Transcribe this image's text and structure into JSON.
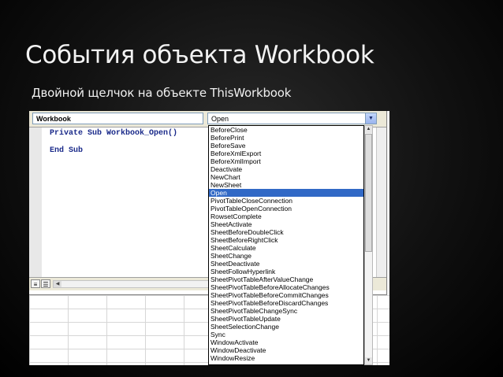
{
  "slide": {
    "title": "События объекта Workbook",
    "subtitle": "Двойной щелчок на объекте ThisWorkbook"
  },
  "vbe": {
    "object_combo_value": "Workbook",
    "procedure_combo_value": "Open",
    "code_lines": [
      "Private Sub Workbook_Open()",
      "End Sub"
    ]
  },
  "dropdown": {
    "selected": "Open",
    "items": [
      "BeforeClose",
      "BeforePrint",
      "BeforeSave",
      "BeforeXmlExport",
      "BeforeXmlImport",
      "Deactivate",
      "NewChart",
      "NewSheet",
      "Open",
      "PivotTableCloseConnection",
      "PivotTableOpenConnection",
      "RowsetComplete",
      "SheetActivate",
      "SheetBeforeDoubleClick",
      "SheetBeforeRightClick",
      "SheetCalculate",
      "SheetChange",
      "SheetDeactivate",
      "SheetFollowHyperlink",
      "SheetPivotTableAfterValueChange",
      "SheetPivotTableBeforeAllocateChanges",
      "SheetPivotTableBeforeCommitChanges",
      "SheetPivotTableBeforeDiscardChanges",
      "SheetPivotTableChangeSync",
      "SheetPivotTableUpdate",
      "SheetSelectionChange",
      "Sync",
      "WindowActivate",
      "WindowDeactivate",
      "WindowResize"
    ]
  },
  "icons": {
    "dropdown_arrow": "chevron-down-icon",
    "procedure_view": "procedure-view-icon",
    "full_module_view": "full-module-view-icon"
  },
  "colors": {
    "selection": "#3169c6",
    "code_keyword": "#1a2a8a"
  }
}
